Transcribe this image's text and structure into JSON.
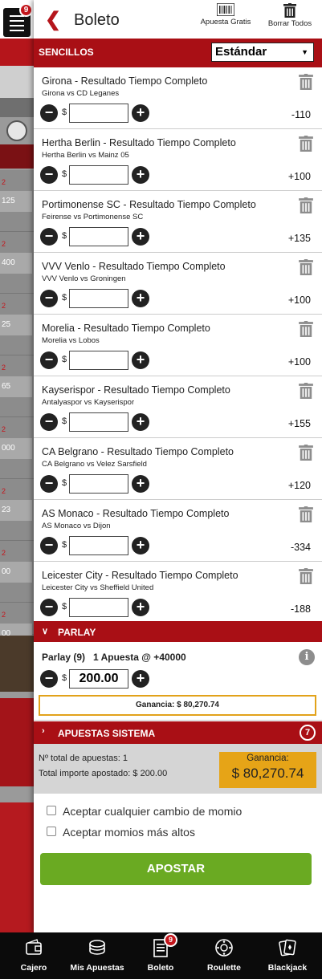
{
  "background": {
    "badge_count": "9",
    "odds_labels": [
      "125",
      "400",
      "25",
      "65",
      "000",
      "23",
      "00",
      "00"
    ]
  },
  "header": {
    "title": "Boleto",
    "free_bet_label": "Apuesta Gratis",
    "clear_all_label": "Borrar Todos"
  },
  "singles": {
    "label": "SENCILLOS",
    "mode_selected": "Estándar",
    "currency": "$",
    "bets": [
      {
        "market": "Girona - Resultado Tiempo Completo",
        "event": "Girona vs CD Leganes",
        "odds": "-110"
      },
      {
        "market": "Hertha Berlin - Resultado Tiempo Completo",
        "event": "Hertha Berlin vs Mainz 05",
        "odds": "+100"
      },
      {
        "market": "Portimonense SC - Resultado Tiempo Completo",
        "event": "Feirense vs Portimonense SC",
        "odds": "+135"
      },
      {
        "market": "VVV Venlo - Resultado Tiempo Completo",
        "event": "VVV Venlo vs Groningen",
        "odds": "+100"
      },
      {
        "market": "Morelia - Resultado Tiempo Completo",
        "event": "Morelia vs Lobos",
        "odds": "+100"
      },
      {
        "market": "Kayserispor - Resultado Tiempo Completo",
        "event": "Antalyaspor vs Kayserispor",
        "odds": "+155"
      },
      {
        "market": "CA Belgrano - Resultado Tiempo Completo",
        "event": "CA Belgrano vs Velez Sarsfield",
        "odds": "+120"
      },
      {
        "market": "AS Monaco - Resultado Tiempo Completo",
        "event": "AS Monaco vs Dijon",
        "odds": "-334"
      },
      {
        "market": "Leicester City - Resultado Tiempo Completo",
        "event": "Leicester City vs Sheffield United",
        "odds": "-188"
      }
    ]
  },
  "parlay": {
    "label": "PARLAY",
    "summary": "Parlay (9)   1 Apuesta @ +40000",
    "info_icon": "i",
    "currency": "$",
    "stake": "200.00",
    "winnings": "Ganancia: $ 80,270.74"
  },
  "system": {
    "label": "APUESTAS SISTEMA",
    "count": "7"
  },
  "totals": {
    "total_bets": "Nº total de apuestas: 1",
    "total_stake": "Total importe apostado: $ 200.00",
    "winnings_label": "Ganancia:",
    "winnings_value": "$ 80,270.74"
  },
  "options": {
    "accept_changes": "Aceptar cualquier cambio de momio",
    "accept_higher": "Aceptar momios más altos"
  },
  "submit_label": "APOSTAR",
  "nav": {
    "items": [
      {
        "label": "Cajero",
        "icon": "wallet-icon"
      },
      {
        "label": "Mis Apuestas",
        "icon": "chips-icon"
      },
      {
        "label": "Boleto",
        "icon": "betslip-icon",
        "badge": "9"
      },
      {
        "label": "Roulette",
        "icon": "roulette-icon"
      },
      {
        "label": "Blackjack",
        "icon": "cards-icon"
      }
    ]
  },
  "colors": {
    "brand_red": "#a90f15",
    "accent_gold": "#e6a417",
    "submit_green": "#6aaa22"
  }
}
